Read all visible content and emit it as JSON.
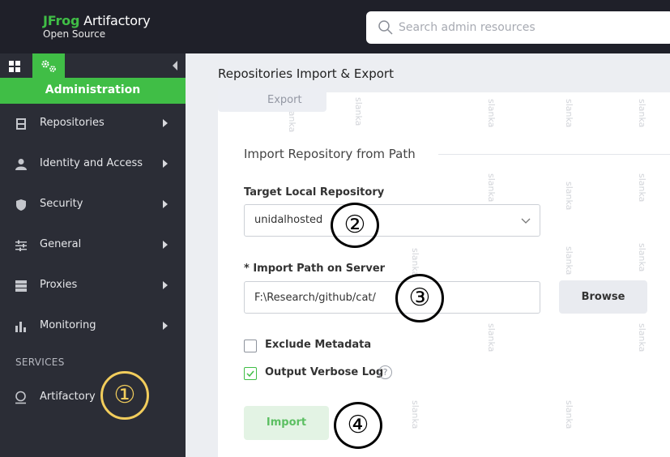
{
  "header": {
    "logo_brand": "JFrog",
    "logo_product": "Artifactory",
    "logo_edition": "Open Source",
    "search_placeholder": "Search admin resources"
  },
  "sidebar": {
    "section_title": "Administration",
    "items": [
      {
        "label": "Repositories",
        "icon": "repositories-icon"
      },
      {
        "label": "Identity and Access",
        "icon": "user-icon"
      },
      {
        "label": "Security",
        "icon": "shield-icon"
      },
      {
        "label": "General",
        "icon": "sliders-icon"
      },
      {
        "label": "Proxies",
        "icon": "server-icon"
      },
      {
        "label": "Monitoring",
        "icon": "bar-chart-icon"
      }
    ],
    "services_header": "SERVICES",
    "services": [
      {
        "label": "Artifactory",
        "icon": "artifactory-icon"
      }
    ]
  },
  "main": {
    "page_title": "Repositories Import & Export",
    "export_button": "Export",
    "import_section_title": "Import Repository from Path",
    "target_repo_label": "Target Local Repository",
    "target_repo_value": "unidalhosted",
    "import_path_label": "* Import Path on Server",
    "import_path_value": "F:\\Research/github/cat/",
    "browse_button": "Browse",
    "exclude_metadata_label": "Exclude Metadata",
    "exclude_metadata_checked": false,
    "verbose_log_label": "Output Verbose Log",
    "verbose_log_checked": true,
    "help_glyph": "?",
    "import_button": "Import"
  },
  "annotations": [
    "①",
    "②",
    "③",
    "④"
  ],
  "watermark": "slanka",
  "colors": {
    "brand_green": "#40be46",
    "topbar": "#1f2029",
    "sidebar": "#2b2d36",
    "annotation_yellow": "#f2cd5c"
  }
}
